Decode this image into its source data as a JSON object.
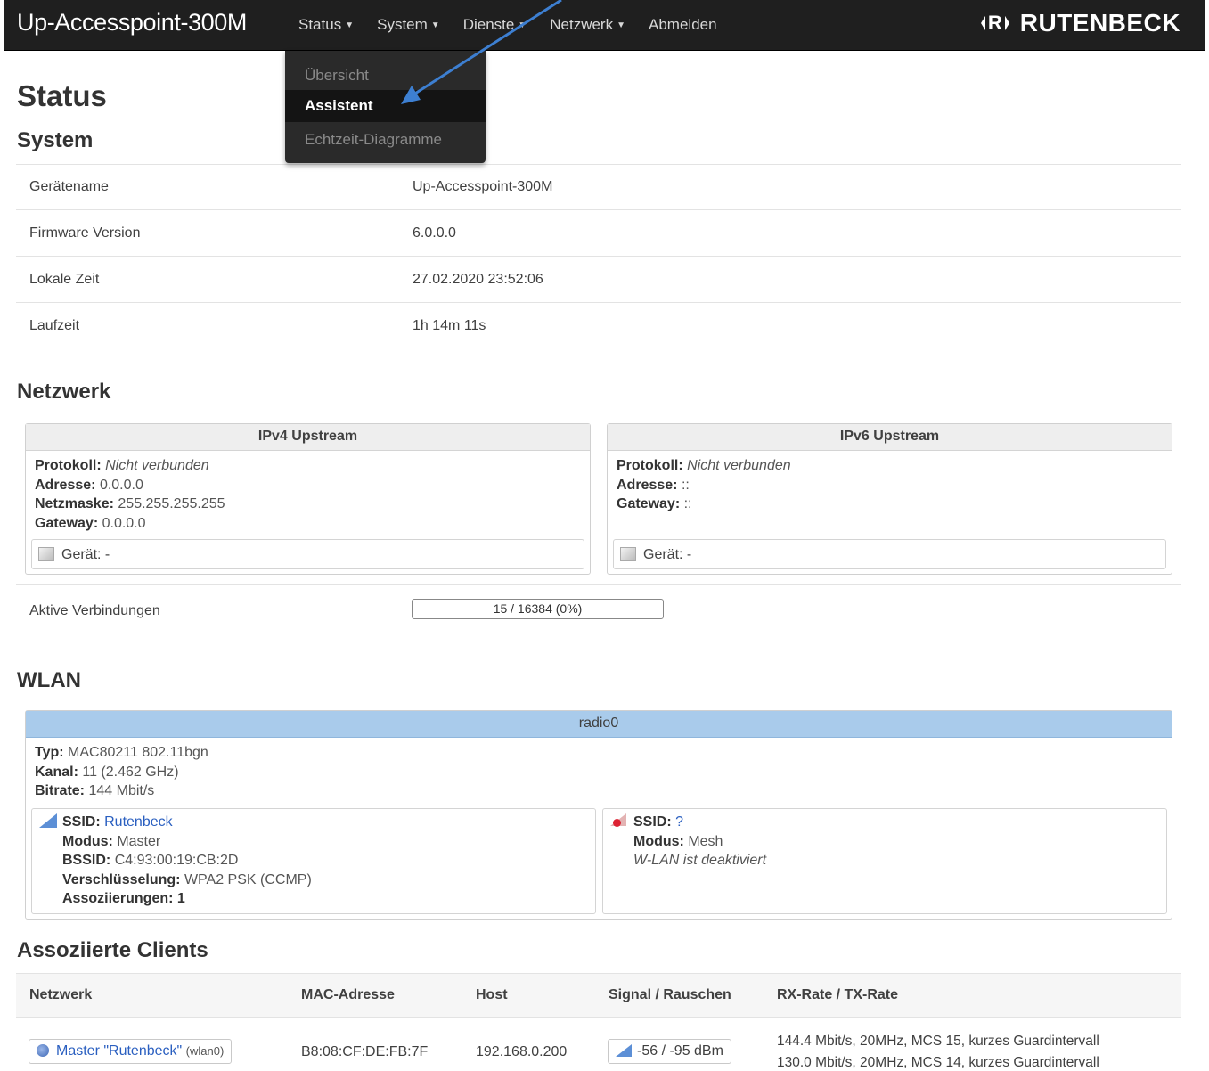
{
  "header": {
    "brand": "Up-Accesspoint-300M",
    "nav": [
      {
        "label": "Status",
        "caret": "▼"
      },
      {
        "label": "System",
        "caret": "▼"
      },
      {
        "label": "Dienste",
        "caret": "▼"
      },
      {
        "label": "Netzwerk",
        "caret": "▼"
      },
      {
        "label": "Abmelden",
        "caret": ""
      }
    ],
    "logo_mark": "R",
    "logo_text": "RUTENBECK"
  },
  "dropdown": {
    "items": [
      "Übersicht",
      "Assistent",
      "Echtzeit-Diagramme"
    ],
    "active": "Assistent"
  },
  "page": {
    "title": "Status"
  },
  "system": {
    "title": "System",
    "rows": [
      {
        "label": "Gerätename",
        "value": "Up-Accesspoint-300M"
      },
      {
        "label": "Firmware Version",
        "value": "6.0.0.0"
      },
      {
        "label": "Lokale Zeit",
        "value": "27.02.2020 23:52:06"
      },
      {
        "label": "Laufzeit",
        "value": "1h 14m 11s"
      }
    ]
  },
  "network": {
    "title": "Netzwerk",
    "ipv4": {
      "title": "IPv4 Upstream",
      "protocol_label": "Protokoll:",
      "protocol": "Nicht verbunden",
      "address_label": "Adresse:",
      "address": "0.0.0.0",
      "netmask_label": "Netzmaske:",
      "netmask": "255.255.255.255",
      "gateway_label": "Gateway:",
      "gateway": "0.0.0.0",
      "device_label": "Gerät:",
      "device": "-"
    },
    "ipv6": {
      "title": "IPv6 Upstream",
      "protocol_label": "Protokoll:",
      "protocol": "Nicht verbunden",
      "address_label": "Adresse:",
      "address": "::",
      "gateway_label": "Gateway:",
      "gateway": "::",
      "device_label": "Gerät:",
      "device": "-"
    },
    "active_connections_label": "Aktive Verbindungen",
    "active_connections": "15 / 16384 (0%)",
    "active_connections_fraction": 0.0009
  },
  "wlan": {
    "title": "WLAN",
    "radio": {
      "name": "radio0",
      "type_label": "Typ:",
      "type": "MAC80211 802.11bgn",
      "channel_label": "Kanal:",
      "channel": "11 (2.462 GHz)",
      "bitrate_label": "Bitrate:",
      "bitrate": "144 Mbit/s"
    },
    "master": {
      "ssid_label": "SSID:",
      "ssid": "Rutenbeck",
      "mode_label": "Modus:",
      "mode": "Master",
      "bssid_label": "BSSID:",
      "bssid": "C4:93:00:19:CB:2D",
      "encryption_label": "Verschlüsselung:",
      "encryption": "WPA2 PSK (CCMP)",
      "assoc_label": "Assoziierungen:",
      "assoc": "1"
    },
    "mesh": {
      "ssid_label": "SSID:",
      "ssid": "?",
      "mode_label": "Modus:",
      "mode": "Mesh",
      "status": "W-LAN ist deaktiviert"
    }
  },
  "clients": {
    "title": "Assoziierte Clients",
    "columns": [
      "Netzwerk",
      "MAC-Adresse",
      "Host",
      "Signal / Rauschen",
      "RX-Rate / TX-Rate"
    ],
    "rows": [
      {
        "network": "Master \"Rutenbeck\"",
        "iface": "(wlan0)",
        "mac": "B8:08:CF:DE:FB:7F",
        "host": "192.168.0.200",
        "signal": "-56 / -95 dBm",
        "rx": "144.4 Mbit/s, 20MHz, MCS 15, kurzes Guardintervall",
        "tx": "130.0 Mbit/s, 20MHz, MCS 14, kurzes Guardintervall"
      }
    ]
  },
  "colors": {
    "topbar": "#1f1f1f",
    "radio_header": "#a9cbeb",
    "link": "#2a5fc0",
    "annotation_arrow": "#3d7fd1"
  }
}
